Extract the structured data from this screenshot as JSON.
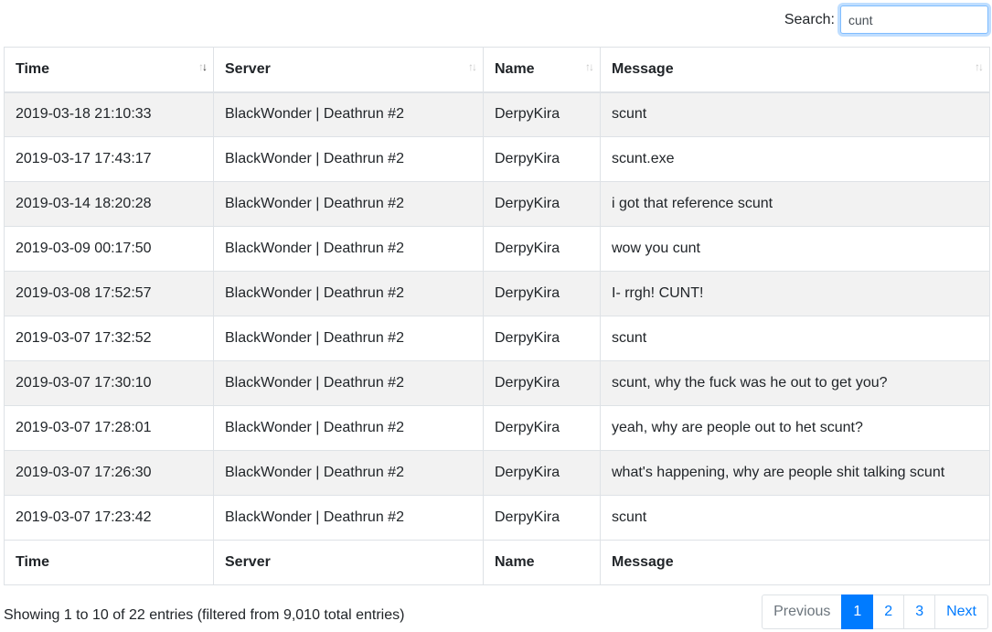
{
  "search": {
    "label": "Search:",
    "value": "cunt"
  },
  "columns": [
    {
      "label": "Time",
      "sort": "desc"
    },
    {
      "label": "Server",
      "sort": "none"
    },
    {
      "label": "Name",
      "sort": "none"
    },
    {
      "label": "Message",
      "sort": "none"
    }
  ],
  "rows": [
    {
      "time": "2019-03-18 21:10:33",
      "server": "BlackWonder | Deathrun #2",
      "name": "DerpyKira",
      "message": "scunt"
    },
    {
      "time": "2019-03-17 17:43:17",
      "server": "BlackWonder | Deathrun #2",
      "name": "DerpyKira",
      "message": "scunt.exe"
    },
    {
      "time": "2019-03-14 18:20:28",
      "server": "BlackWonder | Deathrun #2",
      "name": "DerpyKira",
      "message": "i got that reference scunt"
    },
    {
      "time": "2019-03-09 00:17:50",
      "server": "BlackWonder | Deathrun #2",
      "name": "DerpyKira",
      "message": "wow you cunt"
    },
    {
      "time": "2019-03-08 17:52:57",
      "server": "BlackWonder | Deathrun #2",
      "name": "DerpyKira",
      "message": "I- rrgh! CUNT!"
    },
    {
      "time": "2019-03-07 17:32:52",
      "server": "BlackWonder | Deathrun #2",
      "name": "DerpyKira",
      "message": "scunt"
    },
    {
      "time": "2019-03-07 17:30:10",
      "server": "BlackWonder | Deathrun #2",
      "name": "DerpyKira",
      "message": "scunt, why the fuck was he out to get you?"
    },
    {
      "time": "2019-03-07 17:28:01",
      "server": "BlackWonder | Deathrun #2",
      "name": "DerpyKira",
      "message": "yeah, why are people out to het scunt?"
    },
    {
      "time": "2019-03-07 17:26:30",
      "server": "BlackWonder | Deathrun #2",
      "name": "DerpyKira",
      "message": "what's happening, why are people shit talking scunt"
    },
    {
      "time": "2019-03-07 17:23:42",
      "server": "BlackWonder | Deathrun #2",
      "name": "DerpyKira",
      "message": "scunt"
    }
  ],
  "info": "Showing 1 to 10 of 22 entries (filtered from 9,010 total entries)",
  "pagination": {
    "previous": "Previous",
    "pages": [
      "1",
      "2",
      "3"
    ],
    "active_page": "1",
    "next": "Next"
  },
  "colors": {
    "accent": "#007bff",
    "stripe": "#f2f2f2",
    "border": "#dee2e6"
  }
}
